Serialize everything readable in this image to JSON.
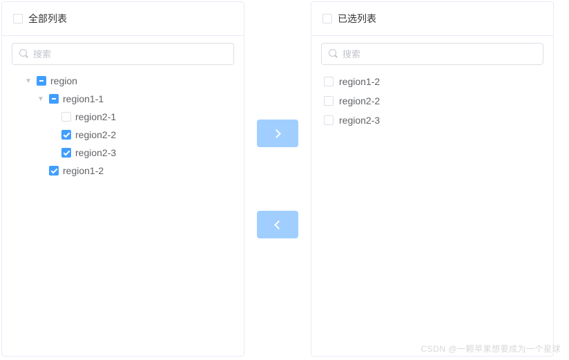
{
  "left": {
    "title": "全部列表",
    "search_placeholder": "搜索",
    "tree": {
      "root": {
        "label": "region",
        "state": "indeterminate"
      },
      "n1": {
        "label": "region1-1",
        "state": "indeterminate"
      },
      "n1a": {
        "label": "region2-1",
        "state": "unchecked"
      },
      "n1b": {
        "label": "region2-2",
        "state": "checked"
      },
      "n1c": {
        "label": "region2-3",
        "state": "checked"
      },
      "n2": {
        "label": "region1-2",
        "state": "checked"
      }
    }
  },
  "right": {
    "title": "已选列表",
    "search_placeholder": "搜索",
    "items": [
      {
        "label": "region1-2"
      },
      {
        "label": "region2-2"
      },
      {
        "label": "region2-3"
      }
    ]
  },
  "watermark": "CSDN @一颗苹果想要成为一个星球"
}
